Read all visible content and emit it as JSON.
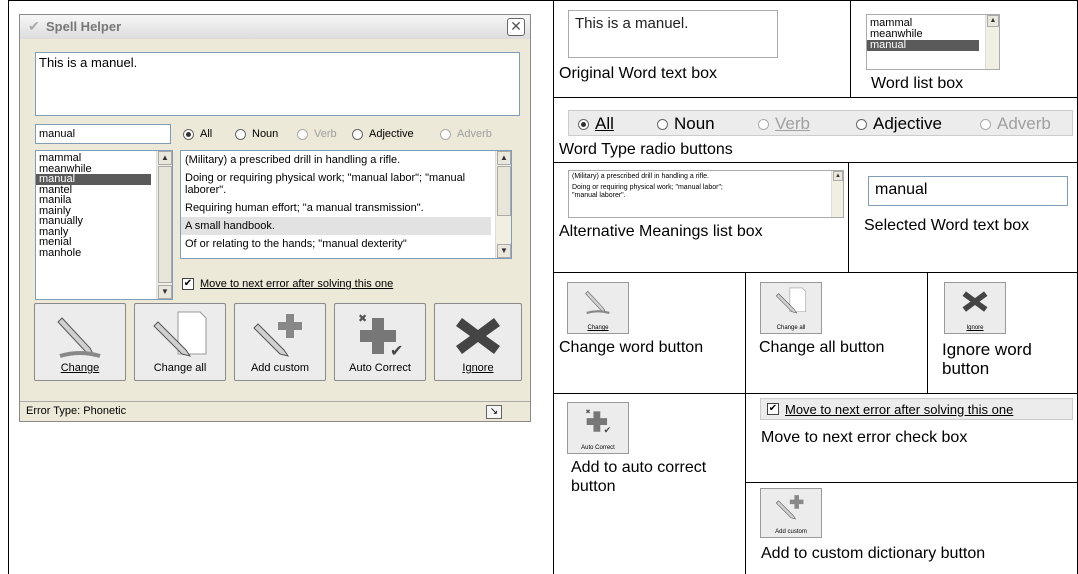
{
  "dialog": {
    "title": "Spell Helper",
    "original_text": "This is a manuel.",
    "selected_word": "manual",
    "radios": {
      "all": "All",
      "noun": "Noun",
      "verb": "Verb",
      "adjective": "Adjective",
      "adverb": "Adverb",
      "selected": "all"
    },
    "word_list": [
      "mammal",
      "meanwhile",
      "manual",
      "mantel",
      "manila",
      "mainly",
      "manually",
      "manly",
      "menial",
      "manhole"
    ],
    "selected_index": 2,
    "meanings": [
      "(Military) a prescribed drill in handling a rifle.",
      "Doing or requiring physical work; \"manual labor\"; \"manual laborer\".",
      "Requiring human effort; \"a manual transmission\".",
      "A small handbook.",
      "Of or relating to the hands; \"manual dexterity\""
    ],
    "move_next_label": "Move to next error after solving this one",
    "move_next_checked": true,
    "buttons": {
      "change": "Change",
      "change_all": "Change all",
      "add_custom": "Add custom",
      "auto_correct": "Auto Correct",
      "ignore": "Ignore"
    },
    "status": "Error Type: Phonetic"
  },
  "guide": {
    "original_text_sample": "This is a manuel.",
    "original_text_caption": "Original Word text box",
    "word_list_sample": [
      "mammal",
      "meanwhile",
      "manual"
    ],
    "word_list_caption": "Word list box",
    "radio_caption": "Word Type radio buttons",
    "meaning_samples": [
      "(Military) a prescribed drill in handling a rifle.",
      "Doing or requiring physical work; \"manual labor\";",
      "\"manual laborer\"."
    ],
    "meanings_caption": "Alternative Meanings list box",
    "selected_word_sample": "manual",
    "selected_word_caption": "Selected Word text box",
    "change_caption": "Change word button",
    "change_all_caption": "Change all button",
    "ignore_caption": "Ignore word button",
    "move_next_caption": "Move to next error check box",
    "auto_correct_caption": "Add to auto correct button",
    "add_custom_caption": "Add to custom dictionary button"
  },
  "colors": {
    "selection": "#5a5a5a",
    "window_bg": "#ece9d8",
    "input_border": "#7f9db9",
    "ignore_icon": "#444444"
  }
}
